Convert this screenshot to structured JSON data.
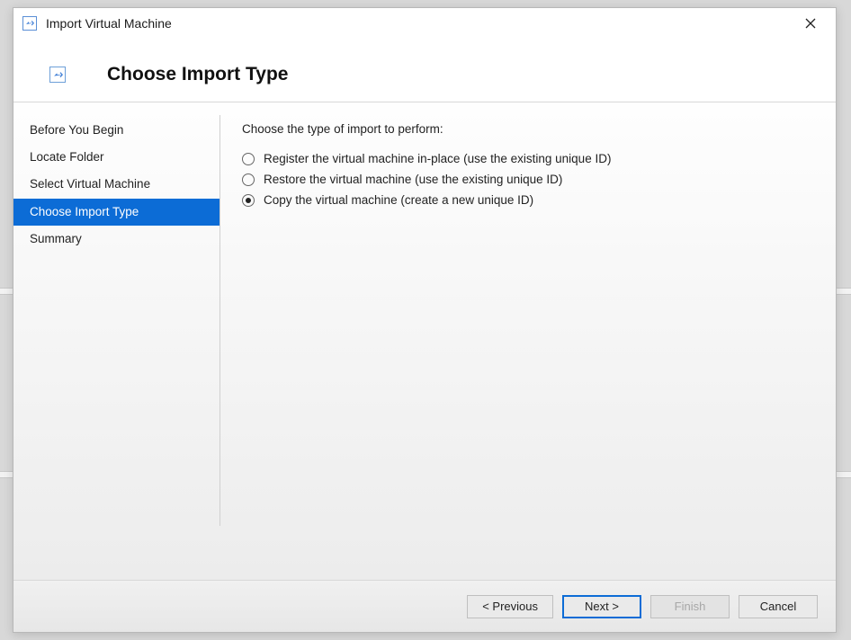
{
  "window": {
    "title": "Import Virtual Machine"
  },
  "page": {
    "heading": "Choose Import Type"
  },
  "steps": {
    "items": [
      {
        "label": "Before You Begin",
        "active": false
      },
      {
        "label": "Locate Folder",
        "active": false
      },
      {
        "label": "Select Virtual Machine",
        "active": false
      },
      {
        "label": "Choose Import Type",
        "active": true
      },
      {
        "label": "Summary",
        "active": false
      }
    ]
  },
  "main": {
    "instruction": "Choose the type of import to perform:",
    "options": [
      {
        "label": "Register the virtual machine in-place (use the existing unique ID)",
        "checked": false
      },
      {
        "label": "Restore the virtual machine (use the existing unique ID)",
        "checked": false
      },
      {
        "label": "Copy the virtual machine (create a new unique ID)",
        "checked": true
      }
    ]
  },
  "footer": {
    "previous": "< Previous",
    "next": "Next >",
    "finish": "Finish",
    "cancel": "Cancel"
  }
}
